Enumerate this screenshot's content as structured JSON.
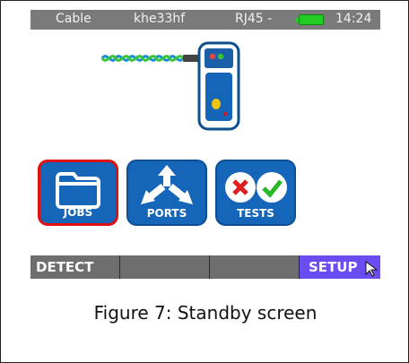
{
  "statusbar": {
    "cable_label": "Cable",
    "cable_id": "khe33hf",
    "port_label": "RJ45 -",
    "battery_icon": "battery-icon",
    "battery_color": "#22cc22",
    "time": "14:24"
  },
  "main_buttons": [
    {
      "label": "JOBS",
      "icon": "folder-icon",
      "selected": true
    },
    {
      "label": "PORTS",
      "icon": "ports-arrows-icon",
      "selected": false
    },
    {
      "label": "TESTS",
      "icon": "tests-icon",
      "selected": false
    }
  ],
  "softkeys": [
    "DETECT",
    "",
    "",
    "SETUP"
  ],
  "caption": "Figure 7: Standby screen",
  "colors": {
    "statusbar": "#7a7a7a",
    "button_blue": "#1565b8",
    "selected_border": "#e01010",
    "softkey_gray": "#6e6e6e",
    "softkey_active": "#6a4cf0"
  }
}
